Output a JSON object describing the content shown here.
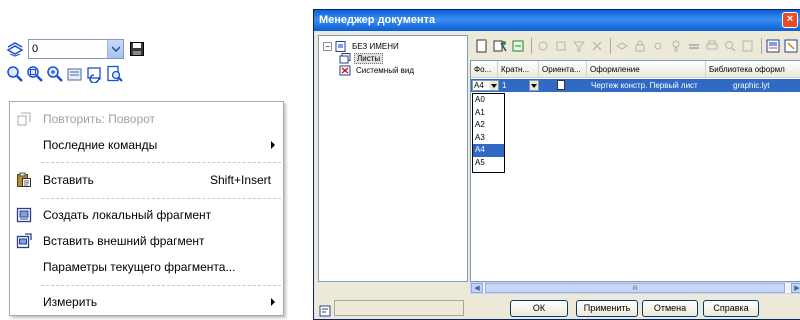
{
  "toolbar": {
    "layer_value": "0",
    "icons_row1": [
      "layers-icon",
      "save-icon"
    ],
    "icons_row2": [
      "zoom-icon",
      "zoom-window-icon",
      "zoom-scale-icon",
      "zoom-all-icon",
      "refresh-icon",
      "preview-icon"
    ]
  },
  "context_menu": {
    "items": [
      {
        "label": "Повторить: Поворот",
        "icon": "repeat-icon",
        "disabled": true
      },
      {
        "label": "Последние команды",
        "submenu": true
      },
      {
        "label": "Вставить",
        "icon": "paste-icon",
        "shortcut": "Shift+Insert"
      },
      {
        "label": "Создать локальный фрагмент",
        "icon": "local-fragment-icon"
      },
      {
        "label": "Вставить внешний фрагмент",
        "icon": "external-fragment-icon"
      },
      {
        "label": "Параметры текущего фрагмента..."
      },
      {
        "label": "Измерить",
        "submenu": true
      }
    ]
  },
  "doc_manager": {
    "title": "Менеджер документа",
    "close_label": "×",
    "tree": {
      "root": "БЕЗ ИМЕНИ",
      "expander": "−",
      "children": [
        "Листы",
        "Системный вид"
      ]
    },
    "table": {
      "columns": [
        "Фо...",
        "Кратн...",
        "Ориента...",
        "Оформление",
        "Библиотека оформл"
      ],
      "row": {
        "format": "A4",
        "multiplicity": "1",
        "design": "Чертеж констр. Первый лист",
        "library": "graphic.lyt"
      }
    },
    "format_options": [
      "A0",
      "A1",
      "A2",
      "A3",
      "A4",
      "A5"
    ],
    "selected_format": "A4",
    "scroll_grip": "III",
    "buttons": {
      "ok": "ОК",
      "apply": "Применить",
      "cancel": "Отмена",
      "help": "Справка"
    }
  },
  "colors": {
    "titlebar": "#0a5fd6",
    "selection": "#316ac5",
    "disabled_text": "#a0a0a0"
  }
}
